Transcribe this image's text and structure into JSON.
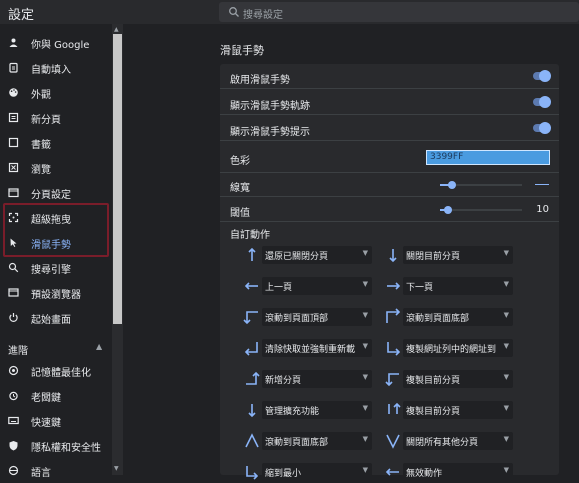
{
  "app_title": "設定",
  "search": {
    "placeholder": "搜尋設定"
  },
  "sidebar": {
    "items": [
      {
        "label": "你與 Google",
        "icon": "person-icon"
      },
      {
        "label": "自動填入",
        "icon": "clipboard-icon"
      },
      {
        "label": "外觀",
        "icon": "palette-icon"
      },
      {
        "label": "新分頁",
        "icon": "new-tab-icon"
      },
      {
        "label": "書籤",
        "icon": "bookmark-square-icon"
      },
      {
        "label": "瀏覽",
        "icon": "browse-icon"
      },
      {
        "label": "分頁設定",
        "icon": "tab-icon"
      },
      {
        "label": "超級拖曳",
        "icon": "drag-icon"
      },
      {
        "label": "滑鼠手勢",
        "icon": "cursor-icon",
        "active": true
      },
      {
        "label": "搜尋引擎",
        "icon": "search-icon"
      },
      {
        "label": "預設瀏覽器",
        "icon": "browser-icon"
      },
      {
        "label": "起始畫面",
        "icon": "power-icon"
      }
    ],
    "advanced_header": "進階",
    "advanced_items": [
      {
        "label": "記憶體最佳化",
        "icon": "memory-icon"
      },
      {
        "label": "老闆鍵",
        "icon": "alarm-icon"
      },
      {
        "label": "快速鍵",
        "icon": "keyboard-icon"
      },
      {
        "label": "隱私權和安全性",
        "icon": "shield-icon"
      },
      {
        "label": "語言",
        "icon": "globe-icon"
      }
    ]
  },
  "main": {
    "title": "滑鼠手勢",
    "settings": {
      "enable": {
        "label": "啟用滑鼠手勢",
        "on": true
      },
      "show_trail": {
        "label": "顯示滑鼠手勢軌跡",
        "on": true
      },
      "show_hint": {
        "label": "顯示滑鼠手勢提示",
        "on": true
      },
      "color": {
        "label": "色彩",
        "value": "3399FF"
      },
      "width": {
        "label": "線寬",
        "level": 0.15
      },
      "threshold": {
        "label": "閾值",
        "value": "10",
        "level": 0.1
      }
    },
    "custom_actions_title": "自訂動作",
    "gestures": [
      {
        "arrow": "up-arrow-icon",
        "action": "還原已關閉分頁"
      },
      {
        "arrow": "down-arrow-icon",
        "action": "關閉目前分頁"
      },
      {
        "arrow": "left-arrow-icon",
        "action": "上一頁"
      },
      {
        "arrow": "right-arrow-icon",
        "action": "下一頁"
      },
      {
        "arrow": "left-up-arrow-icon",
        "action": "滾動到頁面頂部"
      },
      {
        "arrow": "right-down-arrow-icon",
        "action": "滾動到頁面底部"
      },
      {
        "arrow": "down-left-arrow-icon",
        "action": "清除快取並強制重新載"
      },
      {
        "arrow": "down-right-arrow-icon",
        "action": "複製網址列中的網址到"
      },
      {
        "arrow": "right-up-arrow-icon",
        "action": "新增分頁"
      },
      {
        "arrow": "left-down-arrow-icon",
        "action": "複製目前分頁"
      },
      {
        "arrow": "down-arrow-icon",
        "action": "管理擴充功能"
      },
      {
        "arrow": "down-up-arrow-icon",
        "action": "複製目前分頁"
      },
      {
        "arrow": "up-down-arrow-icon",
        "action": "滾動到頁面底部"
      },
      {
        "arrow": "left-down-right-arrow-icon",
        "action": "關閉所有其他分頁"
      },
      {
        "arrow": "left-right-arrow-icon",
        "action": "縮到最小"
      },
      {
        "arrow": "right-left-arrow-icon",
        "action": "無效動作"
      }
    ]
  },
  "colors": {
    "accent": "#8ab4f8",
    "background": "#202124",
    "card": "#292a2d",
    "highlight_border": "#7a1d2a",
    "color_swatch": "#3399FF"
  }
}
